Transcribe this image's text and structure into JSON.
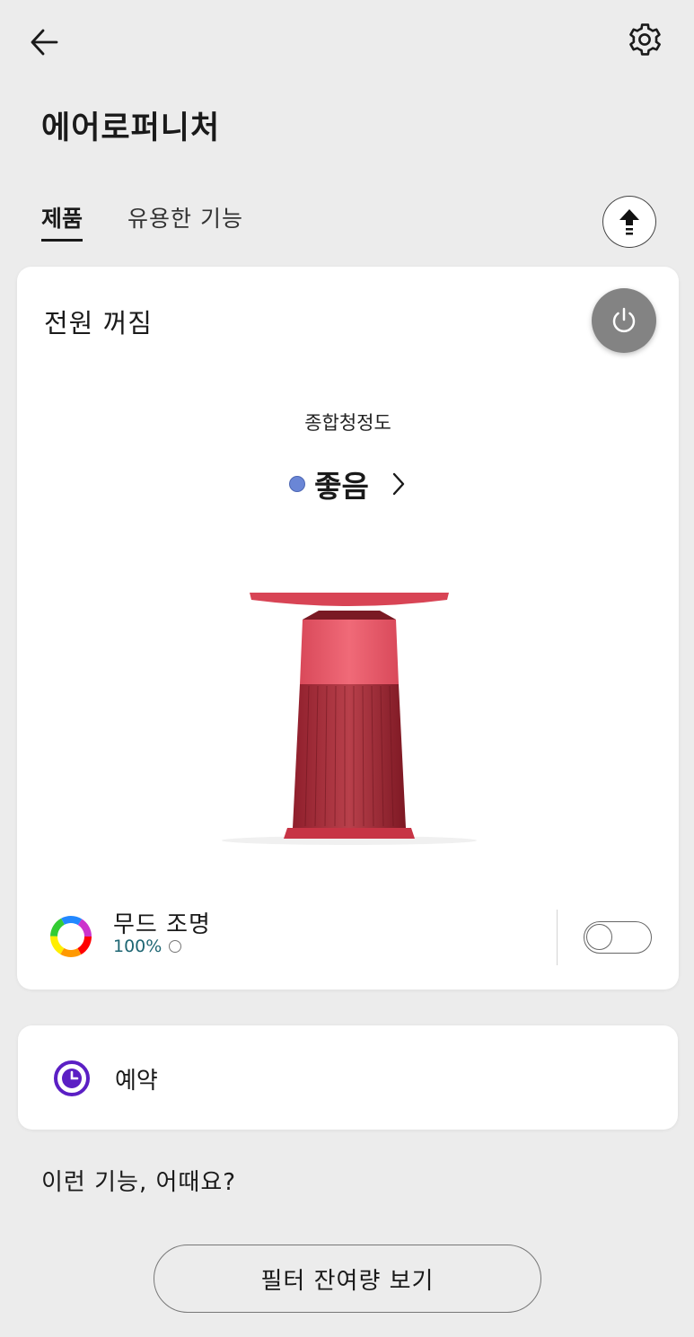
{
  "header": {
    "back_icon": "arrow-left-icon",
    "settings_icon": "gear-icon",
    "title": "에어로퍼니처"
  },
  "tabs": [
    {
      "label": "제품",
      "active": true
    },
    {
      "label": "유용한 기능",
      "active": false
    }
  ],
  "upload_icon": "upload-arrow-icon",
  "device": {
    "power_status": "전원 꺼짐",
    "power_icon": "power-icon",
    "air_quality": {
      "label": "종합청정도",
      "value": "좋음",
      "indicator_color": "#6a86d6"
    },
    "product_color": "#d43c4f",
    "mood_light": {
      "label": "무드 조명",
      "brightness": "100%",
      "icon": "color-wheel-icon",
      "enabled": false
    }
  },
  "schedule": {
    "label": "예약",
    "icon": "clock-icon",
    "icon_color": "#5b1fc4"
  },
  "suggestions": {
    "title": "이런 기능, 어때요?",
    "filter_button": "필터 잔여량 보기"
  }
}
